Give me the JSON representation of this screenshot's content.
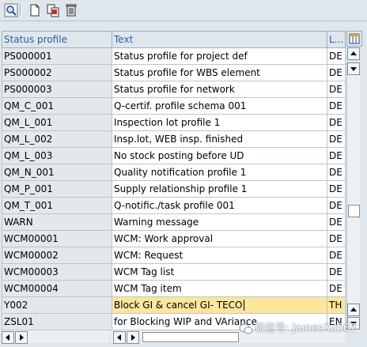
{
  "toolbar": {
    "buttons": [
      "details-icon",
      "new-entries-icon",
      "copy-as-icon",
      "delete-icon"
    ]
  },
  "table": {
    "columns": [
      "Status profile",
      "Text",
      "L..."
    ],
    "rows": [
      [
        "PS000001",
        "Status profile for project def",
        "DE"
      ],
      [
        "PS000002",
        "Status profile for WBS element",
        "DE"
      ],
      [
        "PS000003",
        "Status profile for network",
        "DE"
      ],
      [
        "QM_C_001",
        "Q-certif. profile schema 001",
        "DE"
      ],
      [
        "QM_L_001",
        "Inspection lot profile 1",
        "DE"
      ],
      [
        "QM_L_002",
        "Insp.lot, WEB insp. finished",
        "DE"
      ],
      [
        "QM_L_003",
        "No stock posting before UD",
        "DE"
      ],
      [
        "QM_N_001",
        "Quality notification profile 1",
        "DE"
      ],
      [
        "QM_P_001",
        "Supply relationship profile 1",
        "DE"
      ],
      [
        "QM_T_001",
        "Q-notific./task profile 001",
        "DE"
      ],
      [
        "WARN",
        "Warning message",
        "DE"
      ],
      [
        "WCM00001",
        "WCM: Work approval",
        "DE"
      ],
      [
        "WCM00002",
        "WCM: Request",
        "DE"
      ],
      [
        "WCM00003",
        "WCM Tag list",
        "DE"
      ],
      [
        "WCM00004",
        "WCM Tag item",
        "DE"
      ],
      [
        "Y002",
        "Block GI & cancel GI- TECO",
        "TH"
      ],
      [
        "ZSL01",
        "for Blocking WIP and VAriance",
        "EN"
      ]
    ],
    "highlighted_row": 15
  },
  "watermark": "微信号: JamesXu567",
  "colors": {
    "header_text": "#2a5fa8",
    "highlight": "#fde69b",
    "background": "#dfe6ec"
  }
}
